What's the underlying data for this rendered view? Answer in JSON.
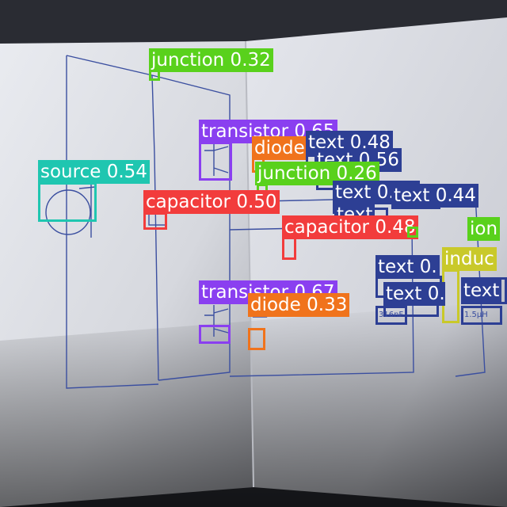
{
  "colors": {
    "transistor": "#8a3ff0",
    "junction": "#59d11c",
    "capacitor": "#f23c3c",
    "source": "#1fc6b0",
    "diode": "#f0731c",
    "text": "#2d3f94",
    "inductor": "#c9c92a"
  },
  "detections": [
    {
      "name": "detection-junction-top",
      "cls": "junction",
      "label": "junction 0.32"
    },
    {
      "name": "detection-transistor-upper",
      "cls": "transistor",
      "label": "transistor 0.65"
    },
    {
      "name": "detection-diode-upper",
      "cls": "diode",
      "label": "diode"
    },
    {
      "name": "detection-text-048",
      "cls": "text",
      "label": "text 0.48"
    },
    {
      "name": "detection-text-056",
      "cls": "text",
      "label": "text 0.56"
    },
    {
      "name": "detection-junction-mid",
      "cls": "junction",
      "label": "junction 0.26"
    },
    {
      "name": "detection-source",
      "cls": "source",
      "label": "source 0.54"
    },
    {
      "name": "detection-capacitor-left",
      "cls": "capacitor",
      "label": "capacitor 0.50"
    },
    {
      "name": "detection-text-050",
      "cls": "text",
      "label": "text 0.50"
    },
    {
      "name": "detection-text-044",
      "cls": "text",
      "label": "text 0.44"
    },
    {
      "name": "detection-text-stacked",
      "cls": "text",
      "label": "text"
    },
    {
      "name": "detection-capacitor-right",
      "cls": "capacitor",
      "label": "capacitor 0.48"
    },
    {
      "name": "detection-junction-right",
      "cls": "junction",
      "label": "ion"
    },
    {
      "name": "detection-inductor",
      "cls": "inductor",
      "label": "induc"
    },
    {
      "name": "detection-text-lower-a",
      "cls": "text",
      "label": "text 0."
    },
    {
      "name": "detection-text-lower-b",
      "cls": "text",
      "label": "text 0."
    },
    {
      "name": "detection-text-lower-c",
      "cls": "text",
      "label": "text"
    },
    {
      "name": "detection-transistor-lower",
      "cls": "transistor",
      "label": "transistor 0.67"
    },
    {
      "name": "detection-diode-lower",
      "cls": "diode",
      "label": "diode 0.33"
    },
    {
      "name": "detection-text-value-left",
      "cls": "text",
      "label": ""
    },
    {
      "name": "detection-text-value-right",
      "cls": "text",
      "label": ""
    }
  ],
  "paper_notes": {
    "value_left": "316nF",
    "value_right": "1.5µH"
  }
}
